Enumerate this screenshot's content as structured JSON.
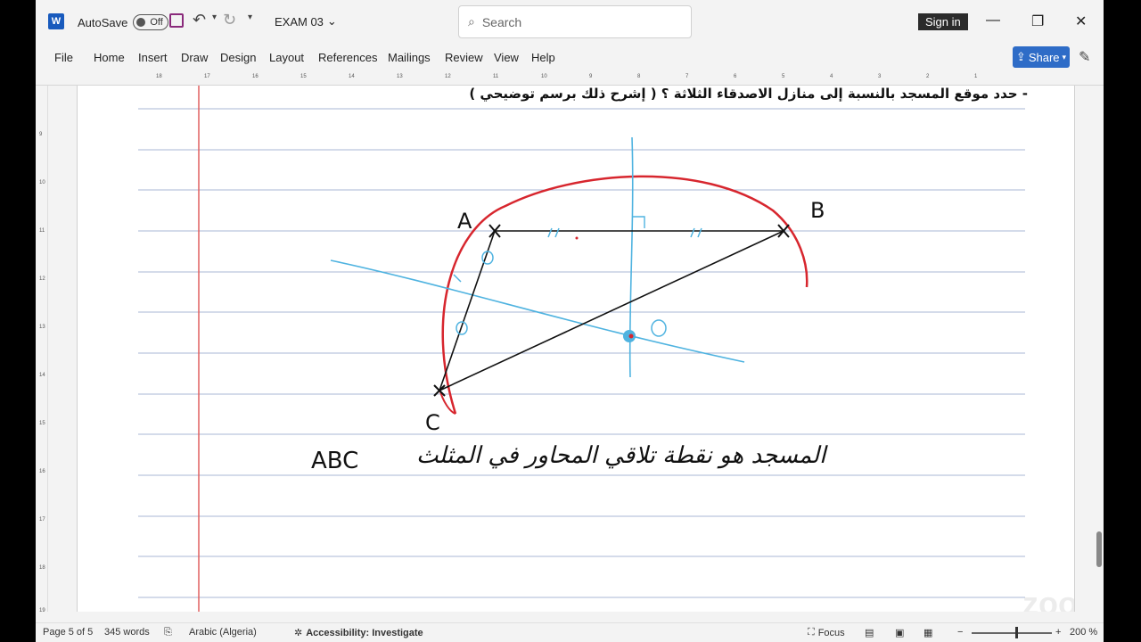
{
  "titlebar": {
    "autosave_label": "AutoSave",
    "autosave_state": "Off",
    "doc_title": "EXAM 03",
    "search_placeholder": "Search",
    "signin_label": "Sign in"
  },
  "menu": {
    "items": [
      "File",
      "Home",
      "Insert",
      "Draw",
      "Design",
      "Layout",
      "References",
      "Mailings",
      "Review",
      "View",
      "Help"
    ],
    "share_label": "Share"
  },
  "ruler": {
    "h_labels": [
      "18",
      "17",
      "16",
      "15",
      "14",
      "13",
      "12",
      "11",
      "10",
      "9",
      "8",
      "7",
      "6",
      "5",
      "4",
      "3",
      "2",
      "1"
    ],
    "v_labels": [
      "9",
      "10",
      "11",
      "12",
      "13",
      "14",
      "15",
      "16",
      "17",
      "18",
      "19"
    ]
  },
  "document": {
    "heading": "-    حدد موقع المسجد بالنسبة إلى منازل الاصدقاء الثلاثة ؟ ( إشرح ذلك برسم توضيحي )",
    "points": {
      "a": "A",
      "b": "B",
      "c": "C"
    },
    "handwritten_arabic": "المسجد هو نقطة تلاقي المحاور في المثلث",
    "handwritten_abc": "ABC"
  },
  "status": {
    "page": "Page 5 of 5",
    "words": "345 words",
    "language": "Arabic (Algeria)",
    "accessibility": "Accessibility: Investigate",
    "focus": "Focus",
    "zoom": "200 %"
  },
  "colors": {
    "accent": "#2e6cc7",
    "margin_line": "#e06060",
    "rule_line": "#a9b7d6",
    "circle": "#d7262e",
    "bisector": "#4fb3e0"
  }
}
